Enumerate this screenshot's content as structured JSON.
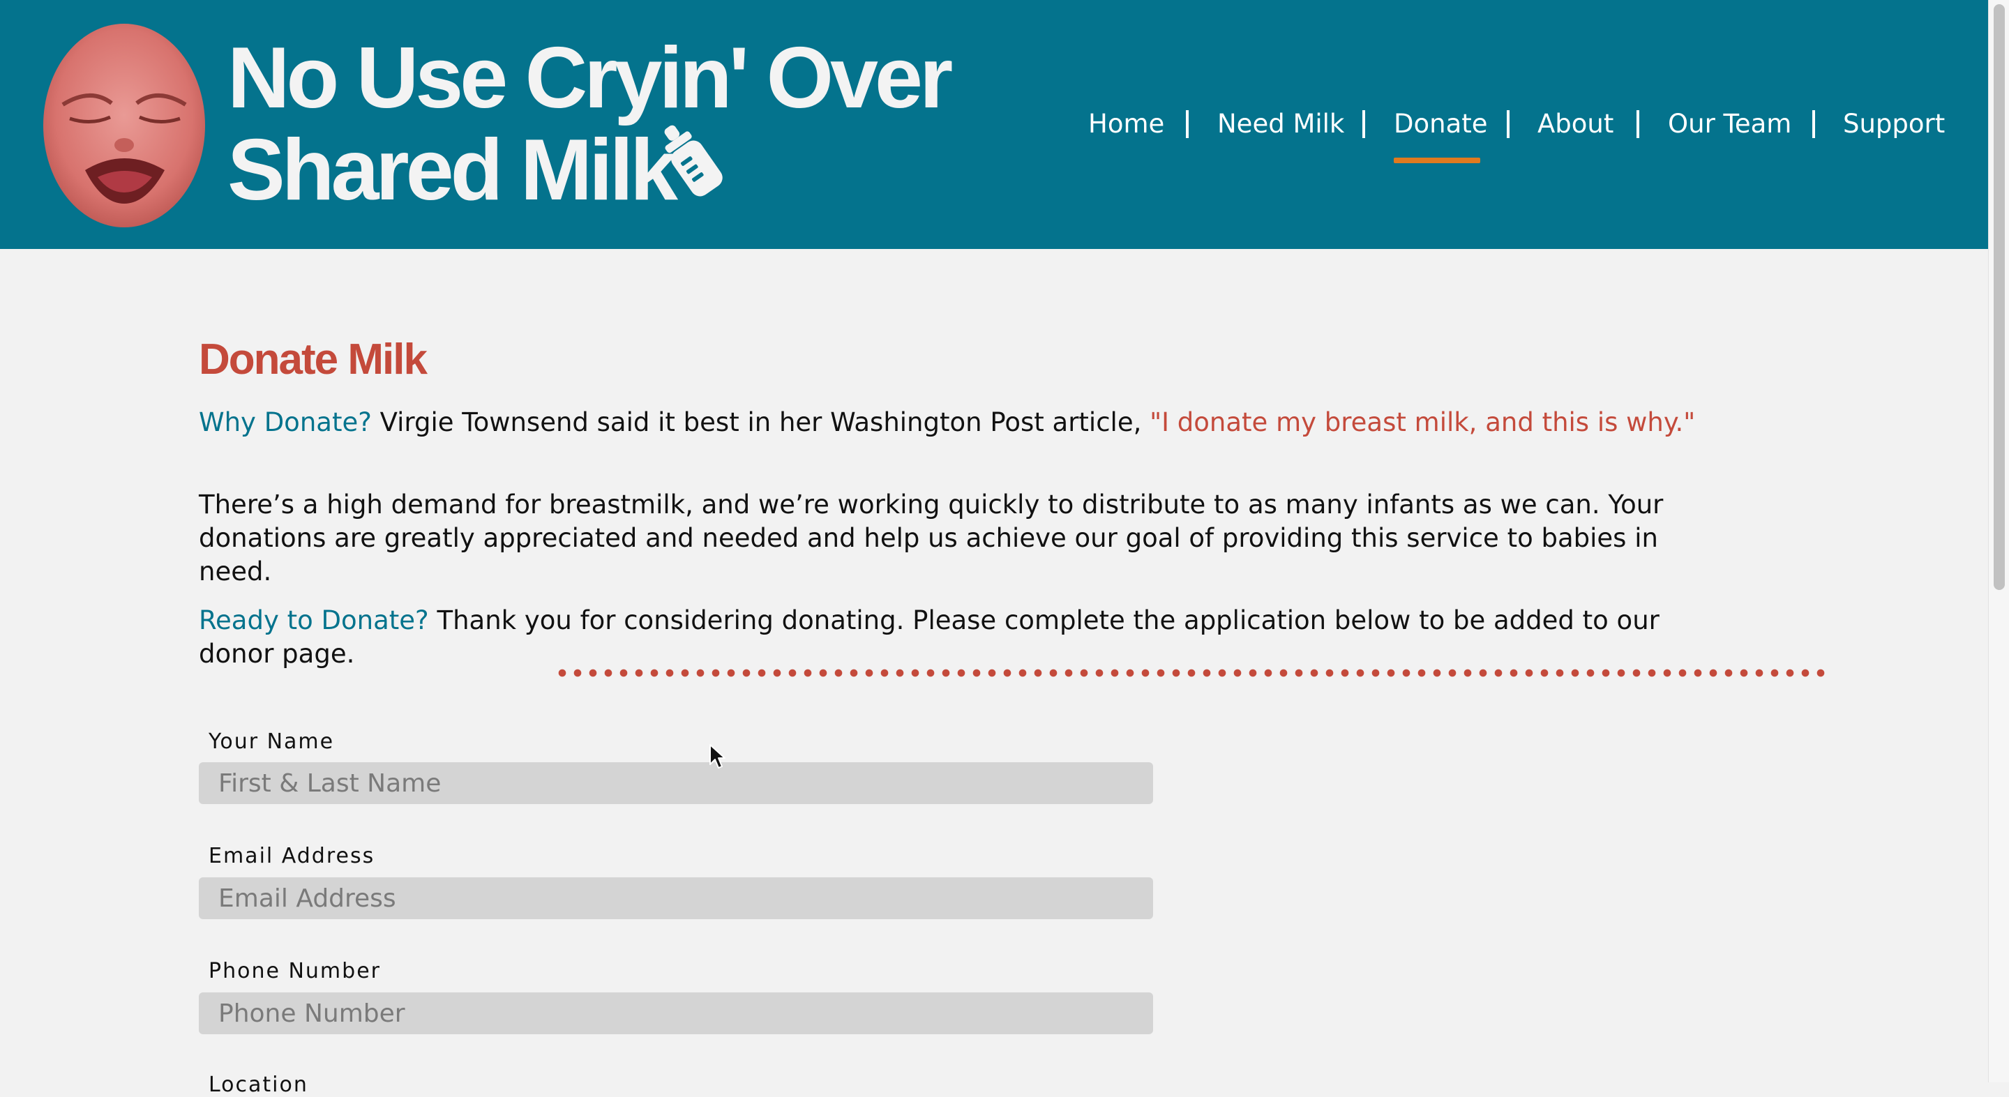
{
  "header": {
    "title_line1": "No Use Cryin' Over",
    "title_line2": "Shared Milk",
    "logo_icon": "crying-baby-logo",
    "bottle_icon": "baby-bottle-icon",
    "background_color": "#04738d"
  },
  "nav": {
    "items": [
      {
        "label": "Home"
      },
      {
        "label": "Need Milk"
      },
      {
        "label": "Donate",
        "active": true
      },
      {
        "label": "About"
      },
      {
        "label": "Our Team"
      },
      {
        "label": "Support"
      }
    ],
    "separator": "|",
    "active_color": "#e07a1f"
  },
  "main": {
    "title": "Donate Milk",
    "why_lead": "Why Donate?",
    "why_text": " Virgie Townsend said it best in her Washington Post article, ",
    "why_link": "\"I donate my breast milk, and this is why.\"",
    "demand_text": "There’s a high demand for breastmilk, and we’re working quickly to distribute to as many infants as we can. Your donations are greatly appreciated and needed and help us achieve our goal of providing this service to babies in need.",
    "ready_lead": "Ready to Donate?",
    "ready_text": " Thank you for considering donating. Please complete the application below to be added to our donor page."
  },
  "form": {
    "name": {
      "label": "Your Name",
      "placeholder": "First & Last Name",
      "value": ""
    },
    "email": {
      "label": "Email Address",
      "placeholder": "Email Address",
      "value": ""
    },
    "phone": {
      "label": "Phone Number",
      "placeholder": "Phone Number",
      "value": ""
    },
    "location": {
      "label": "Location"
    }
  },
  "colors": {
    "accent_red": "#c44a3b",
    "teal": "#04738d",
    "input_bg": "#d4d4d4",
    "page_bg": "#f2f2f2"
  }
}
